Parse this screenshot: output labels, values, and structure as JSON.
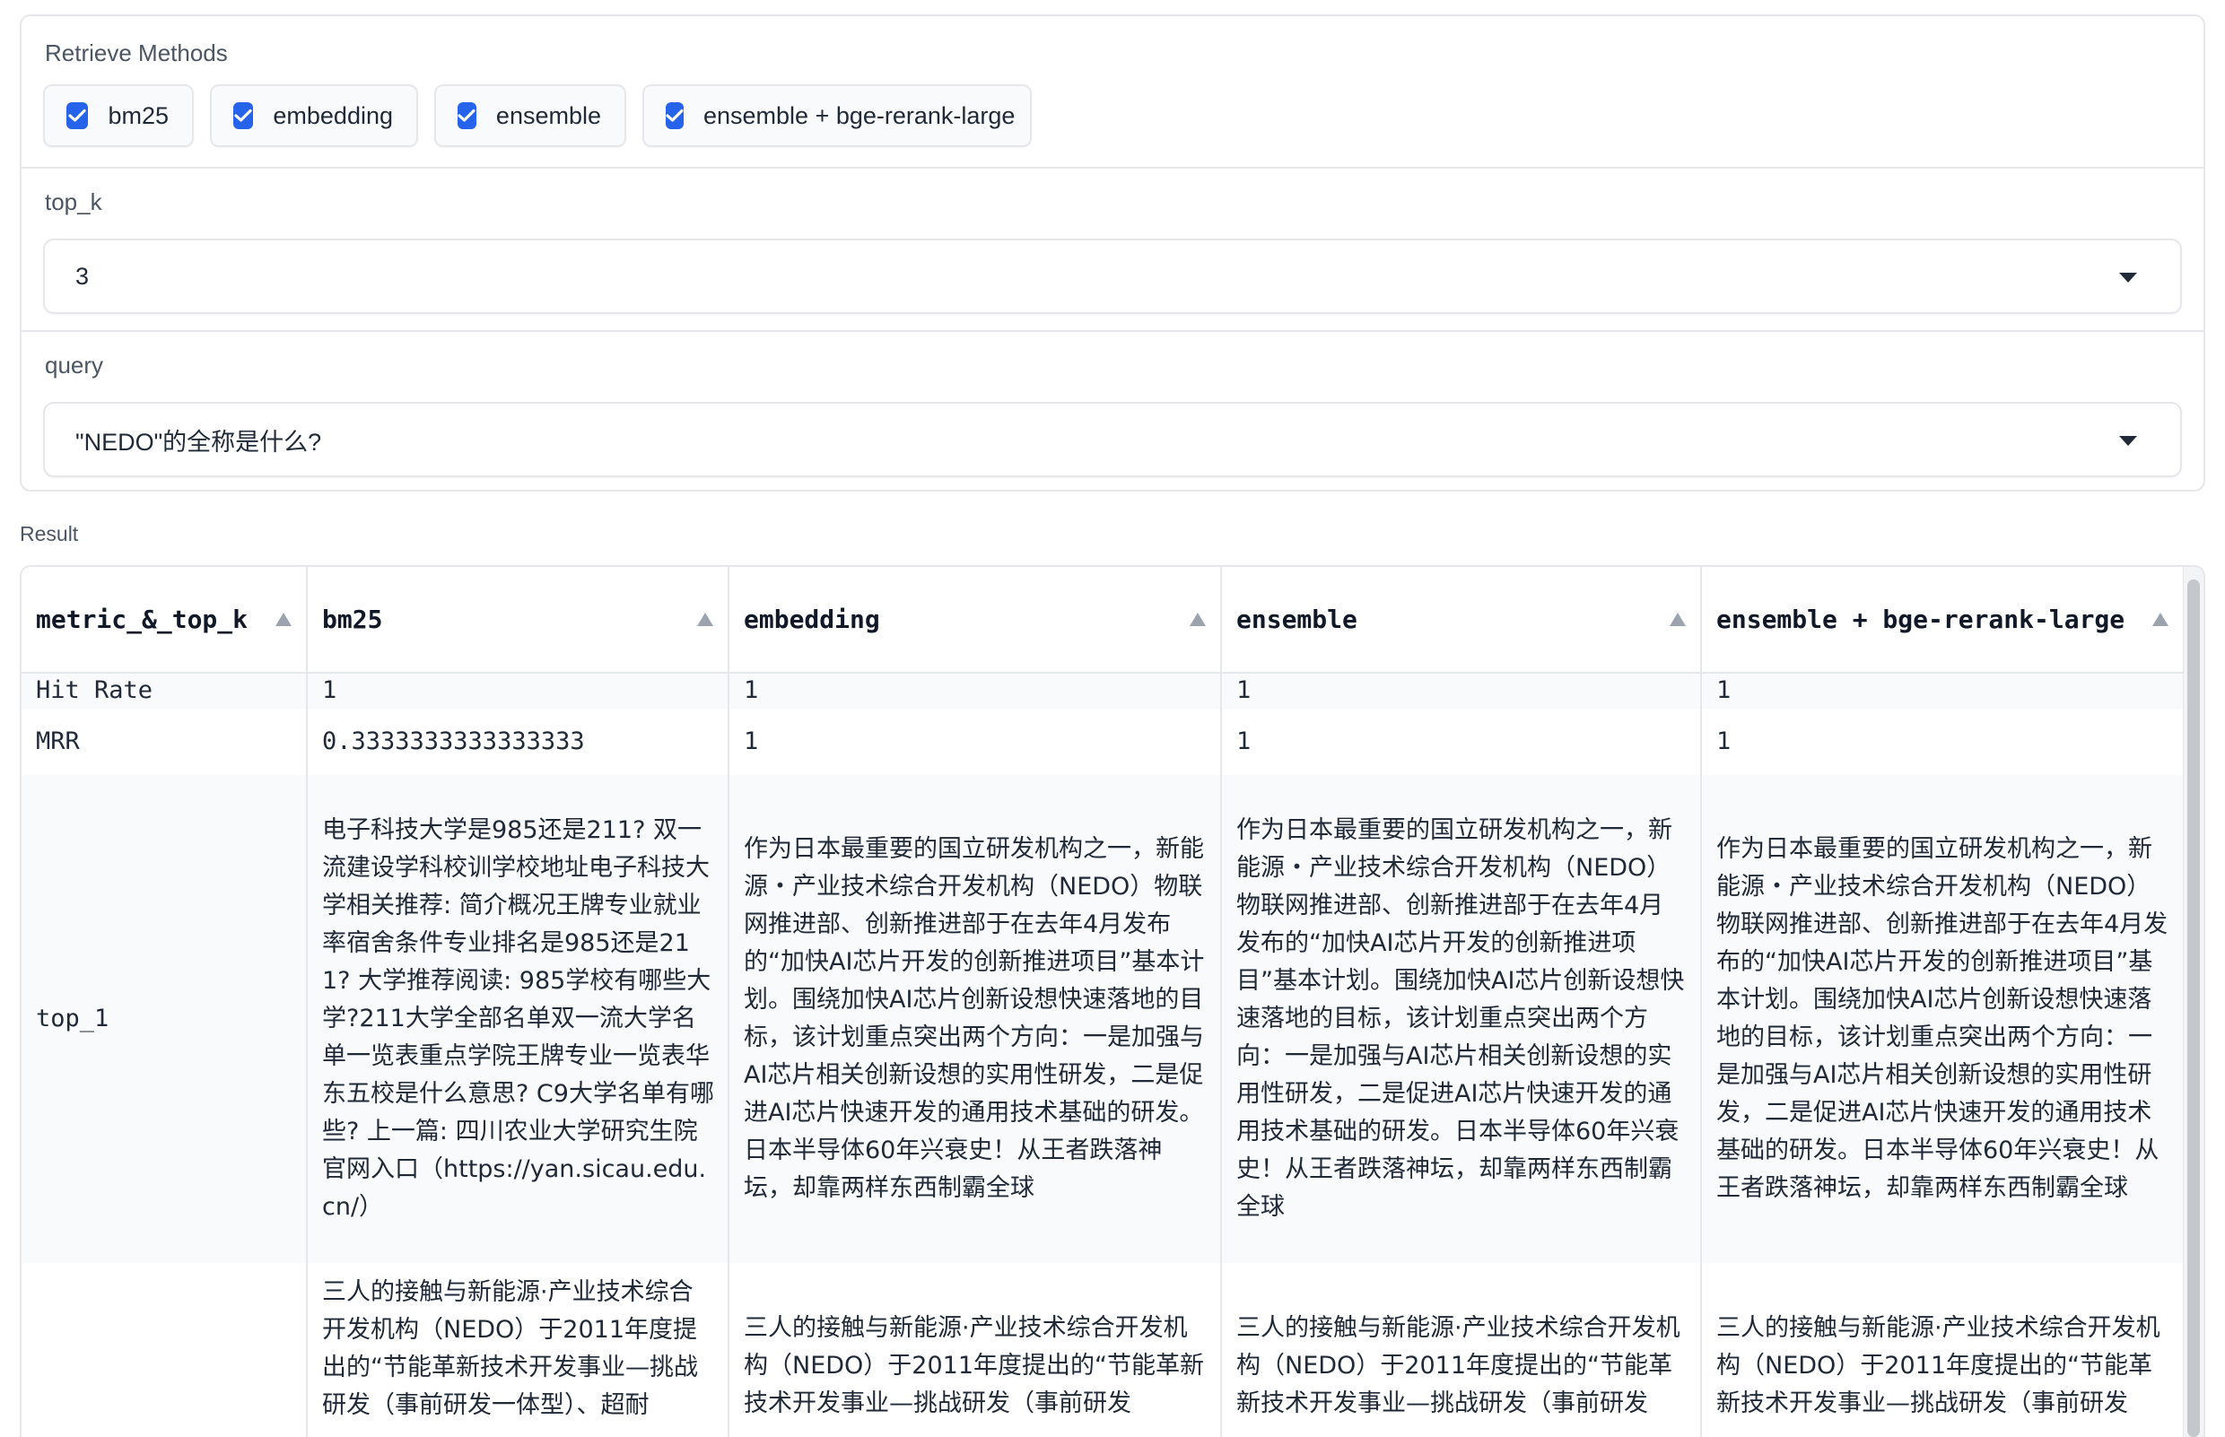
{
  "retrieve_methods": {
    "label": "Retrieve Methods",
    "options": [
      {
        "label": "bm25",
        "checked": true
      },
      {
        "label": "embedding",
        "checked": true
      },
      {
        "label": "ensemble",
        "checked": true
      },
      {
        "label": "ensemble + bge-rerank-large",
        "checked": true
      }
    ]
  },
  "top_k": {
    "label": "top_k",
    "value": "3"
  },
  "query": {
    "label": "query",
    "value": "\"NEDO\"的全称是什么?"
  },
  "result": {
    "label": "Result",
    "headers": [
      "metric_&_top_k",
      "bm25",
      "embedding",
      "ensemble",
      "ensemble + bge-rerank-large"
    ],
    "rows": [
      [
        "Hit Rate",
        "1",
        "1",
        "1",
        "1"
      ],
      [
        "MRR",
        "0.3333333333333333",
        "1",
        "1",
        "1"
      ],
      [
        "top_1",
        "电子科技大学是985还是211? 双一流建设学科校训学校地址电子科技大学相关推荐: 简介概况王牌专业就业率宿舍条件专业排名是985还是211? 大学推荐阅读: 985学校有哪些大学?211大学全部名单双一流大学名单一览表重点学院王牌专业一览表华东五校是什么意思? C9大学名单有哪些? 上一篇: 四川农业大学研究生院官网入口（https://yan.sicau.edu.cn/）",
        "作为日本最重要的国立研发机构之一，新能源・产业技术综合开发机构（NEDO）物联网推进部、创新推进部于在去年4月发布的“加快AI芯片开发的创新推进项目”基本计划。围绕加快AI芯片创新设想快速落地的目标，该计划重点突出两个方向：一是加强与AI芯片相关创新设想的实用性研发，二是促进AI芯片快速开发的通用技术基础的研发。日本半导体60年兴衰史！从王者跌落神坛，却靠两样东西制霸全球",
        "作为日本最重要的国立研发机构之一，新能源・产业技术综合开发机构（NEDO）物联网推进部、创新推进部于在去年4月发布的“加快AI芯片开发的创新推进项目”基本计划。围绕加快AI芯片创新设想快速落地的目标，该计划重点突出两个方向：一是加强与AI芯片相关创新设想的实用性研发，二是促进AI芯片快速开发的通用技术基础的研发。日本半导体60年兴衰史！从王者跌落神坛，却靠两样东西制霸全球",
        "作为日本最重要的国立研发机构之一，新能源・产业技术综合开发机构（NEDO）物联网推进部、创新推进部于在去年4月发布的“加快AI芯片开发的创新推进项目”基本计划。围绕加快AI芯片创新设想快速落地的目标，该计划重点突出两个方向：一是加强与AI芯片相关创新设想的实用性研发，二是促进AI芯片快速开发的通用技术基础的研发。日本半导体60年兴衰史！从王者跌落神坛，却靠两样东西制霸全球"
      ],
      [
        "",
        "三人的接触与新能源·产业技术综合开发机构（NEDO）于2011年度提出的“节能革新技术开发事业—挑战研发（事前研发一体型）、超耐",
        "三人的接触与新能源·产业技术综合开发机构（NEDO）于2011年度提出的“节能革新技术开发事业—挑战研发（事前研发",
        "三人的接触与新能源·产业技术综合开发机构（NEDO）于2011年度提出的“节能革新技术开发事业—挑战研发（事前研发",
        "三人的接触与新能源·产业技术综合开发机构（NEDO）于2011年度提出的“节能革新技术开发事业—挑战研发（事前研发"
      ]
    ]
  },
  "colors": {
    "accent": "#2563eb",
    "border": "#e5e7eb",
    "row_alt": "#f9fafb"
  }
}
